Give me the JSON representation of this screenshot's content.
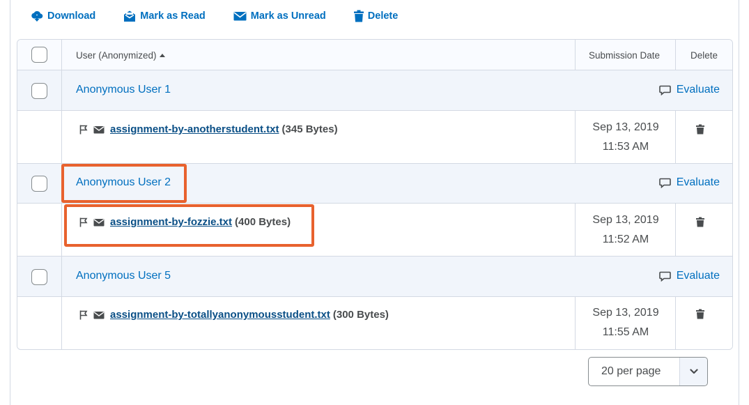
{
  "toolbar": {
    "download": "Download",
    "mark_read": "Mark as Read",
    "mark_unread": "Mark as Unread",
    "delete": "Delete"
  },
  "table": {
    "headers": {
      "user": "User (Anonymized)",
      "submission_date": "Submission Date",
      "delete": "Delete"
    },
    "groups": [
      {
        "user": "Anonymous User 1",
        "evaluate": "Evaluate",
        "file": "assignment-by-anotherstudent.txt",
        "size": "(345 Bytes)",
        "date": "Sep 13, 2019",
        "time": "11:53 AM"
      },
      {
        "user": "Anonymous User 2",
        "evaluate": "Evaluate",
        "file": "assignment-by-fozzie.txt",
        "size": "(400 Bytes)",
        "date": "Sep 13, 2019",
        "time": "11:52 AM"
      },
      {
        "user": "Anonymous User 5",
        "evaluate": "Evaluate",
        "file": "assignment-by-totallyanonymousstudent.txt",
        "size": "(300 Bytes)",
        "date": "Sep 13, 2019",
        "time": "11:55 AM"
      }
    ]
  },
  "pager": {
    "per_page": "20 per page"
  },
  "colors": {
    "link": "#006fbf",
    "file_link": "#0a4f86",
    "highlight": "#e8622e",
    "group_bg": "#f1f5fb"
  }
}
